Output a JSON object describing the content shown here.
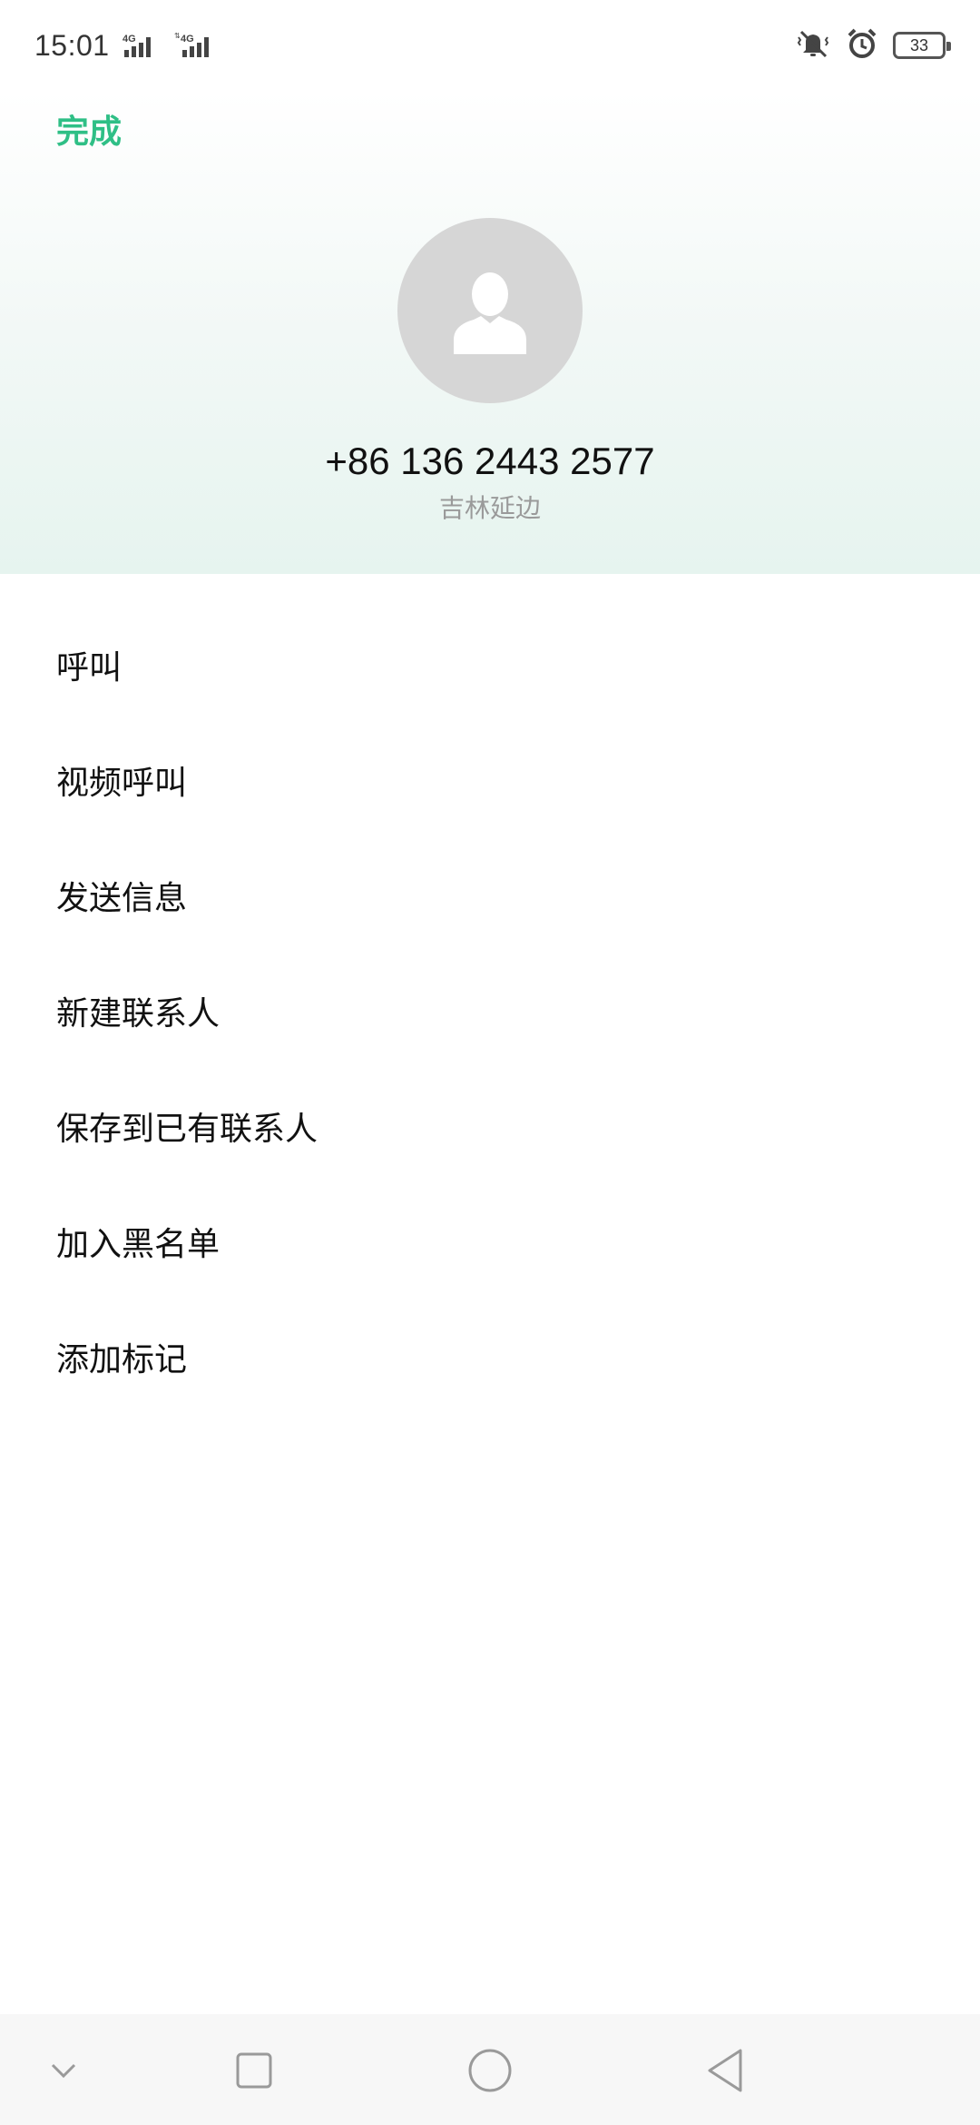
{
  "status_bar": {
    "time": "15:01",
    "network_1": "4G",
    "network_2": "4G",
    "battery_level": "33"
  },
  "header": {
    "done_label": "完成",
    "phone_number": "+86 136 2443 2577",
    "location": "吉林延边"
  },
  "actions": [
    {
      "label": "呼叫"
    },
    {
      "label": "视频呼叫"
    },
    {
      "label": "发送信息"
    },
    {
      "label": "新建联系人"
    },
    {
      "label": "保存到已有联系人"
    },
    {
      "label": "加入黑名单"
    },
    {
      "label": "添加标记"
    }
  ],
  "colors": {
    "accent": "#2fbf86",
    "avatar_bg": "#d6d6d6",
    "secondary_text": "#9a9a9a"
  },
  "icons": {
    "nav_collapse": "chevron-down-icon",
    "nav_recents": "square-icon",
    "nav_home": "circle-icon",
    "nav_back": "triangle-back-icon"
  }
}
